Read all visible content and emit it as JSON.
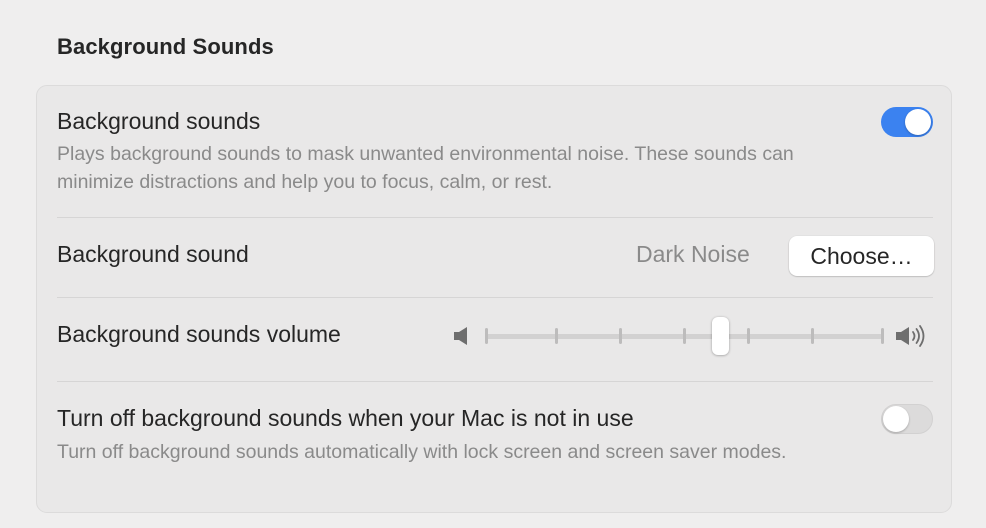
{
  "section": {
    "title": "Background Sounds"
  },
  "background_sounds": {
    "label": "Background sounds",
    "description": "Plays background sounds to mask unwanted environmental noise. These sounds can minimize distractions and help you to focus, calm, or rest.",
    "enabled": true
  },
  "background_sound": {
    "label": "Background sound",
    "value": "Dark Noise",
    "button_label": "Choose…"
  },
  "volume": {
    "label": "Background sounds volume",
    "tick_count": 8,
    "level": 0.6,
    "min_icon": "speaker-low-icon",
    "max_icon": "speaker-high-icon"
  },
  "turn_off": {
    "label": "Turn off background sounds when your Mac is not in use",
    "description": "Turn off background sounds automatically with lock screen and screen saver modes.",
    "enabled": false
  },
  "colors": {
    "accent": "#3b82f0",
    "background": "#efeeee",
    "panel": "#e9e8e8",
    "secondary_text": "#8a8a8a"
  }
}
